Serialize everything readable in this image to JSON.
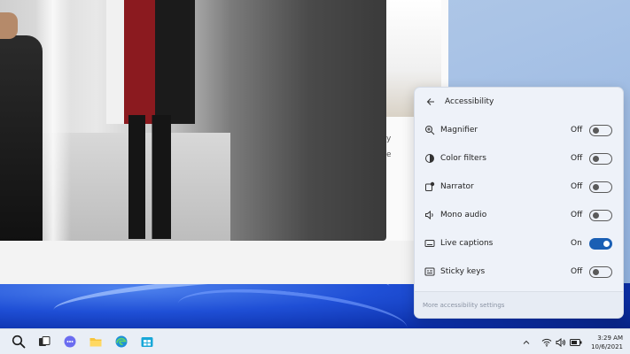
{
  "flyout": {
    "title": "Accessibility",
    "items": [
      {
        "label": "Magnifier",
        "state": "Off",
        "on": false,
        "icon": "magnifier-icon"
      },
      {
        "label": "Color filters",
        "state": "Off",
        "on": false,
        "icon": "color-filters-icon"
      },
      {
        "label": "Narrator",
        "state": "Off",
        "on": false,
        "icon": "narrator-icon"
      },
      {
        "label": "Mono audio",
        "state": "Off",
        "on": false,
        "icon": "mono-audio-icon"
      },
      {
        "label": "Live captions",
        "state": "On",
        "on": true,
        "icon": "live-captions-icon"
      },
      {
        "label": "Sticky keys",
        "state": "Off",
        "on": false,
        "icon": "sticky-keys-icon"
      }
    ],
    "footer_link": "More accessibility settings"
  },
  "app": {
    "stub_text_1": "y",
    "stub_text_2": "e"
  },
  "taskbar": {
    "apps": [
      "search-icon",
      "task-view-icon",
      "chat-icon",
      "file-explorer-icon",
      "edge-icon",
      "store-icon"
    ],
    "tray_icons": [
      "wifi-icon",
      "volume-icon",
      "battery-icon"
    ],
    "time": "3:29 AM",
    "date": "10/6/2021"
  },
  "colors": {
    "accent": "#1a5fb4",
    "flyout_bg": "#eef2f9",
    "taskbar_bg": "#e9eef6"
  }
}
